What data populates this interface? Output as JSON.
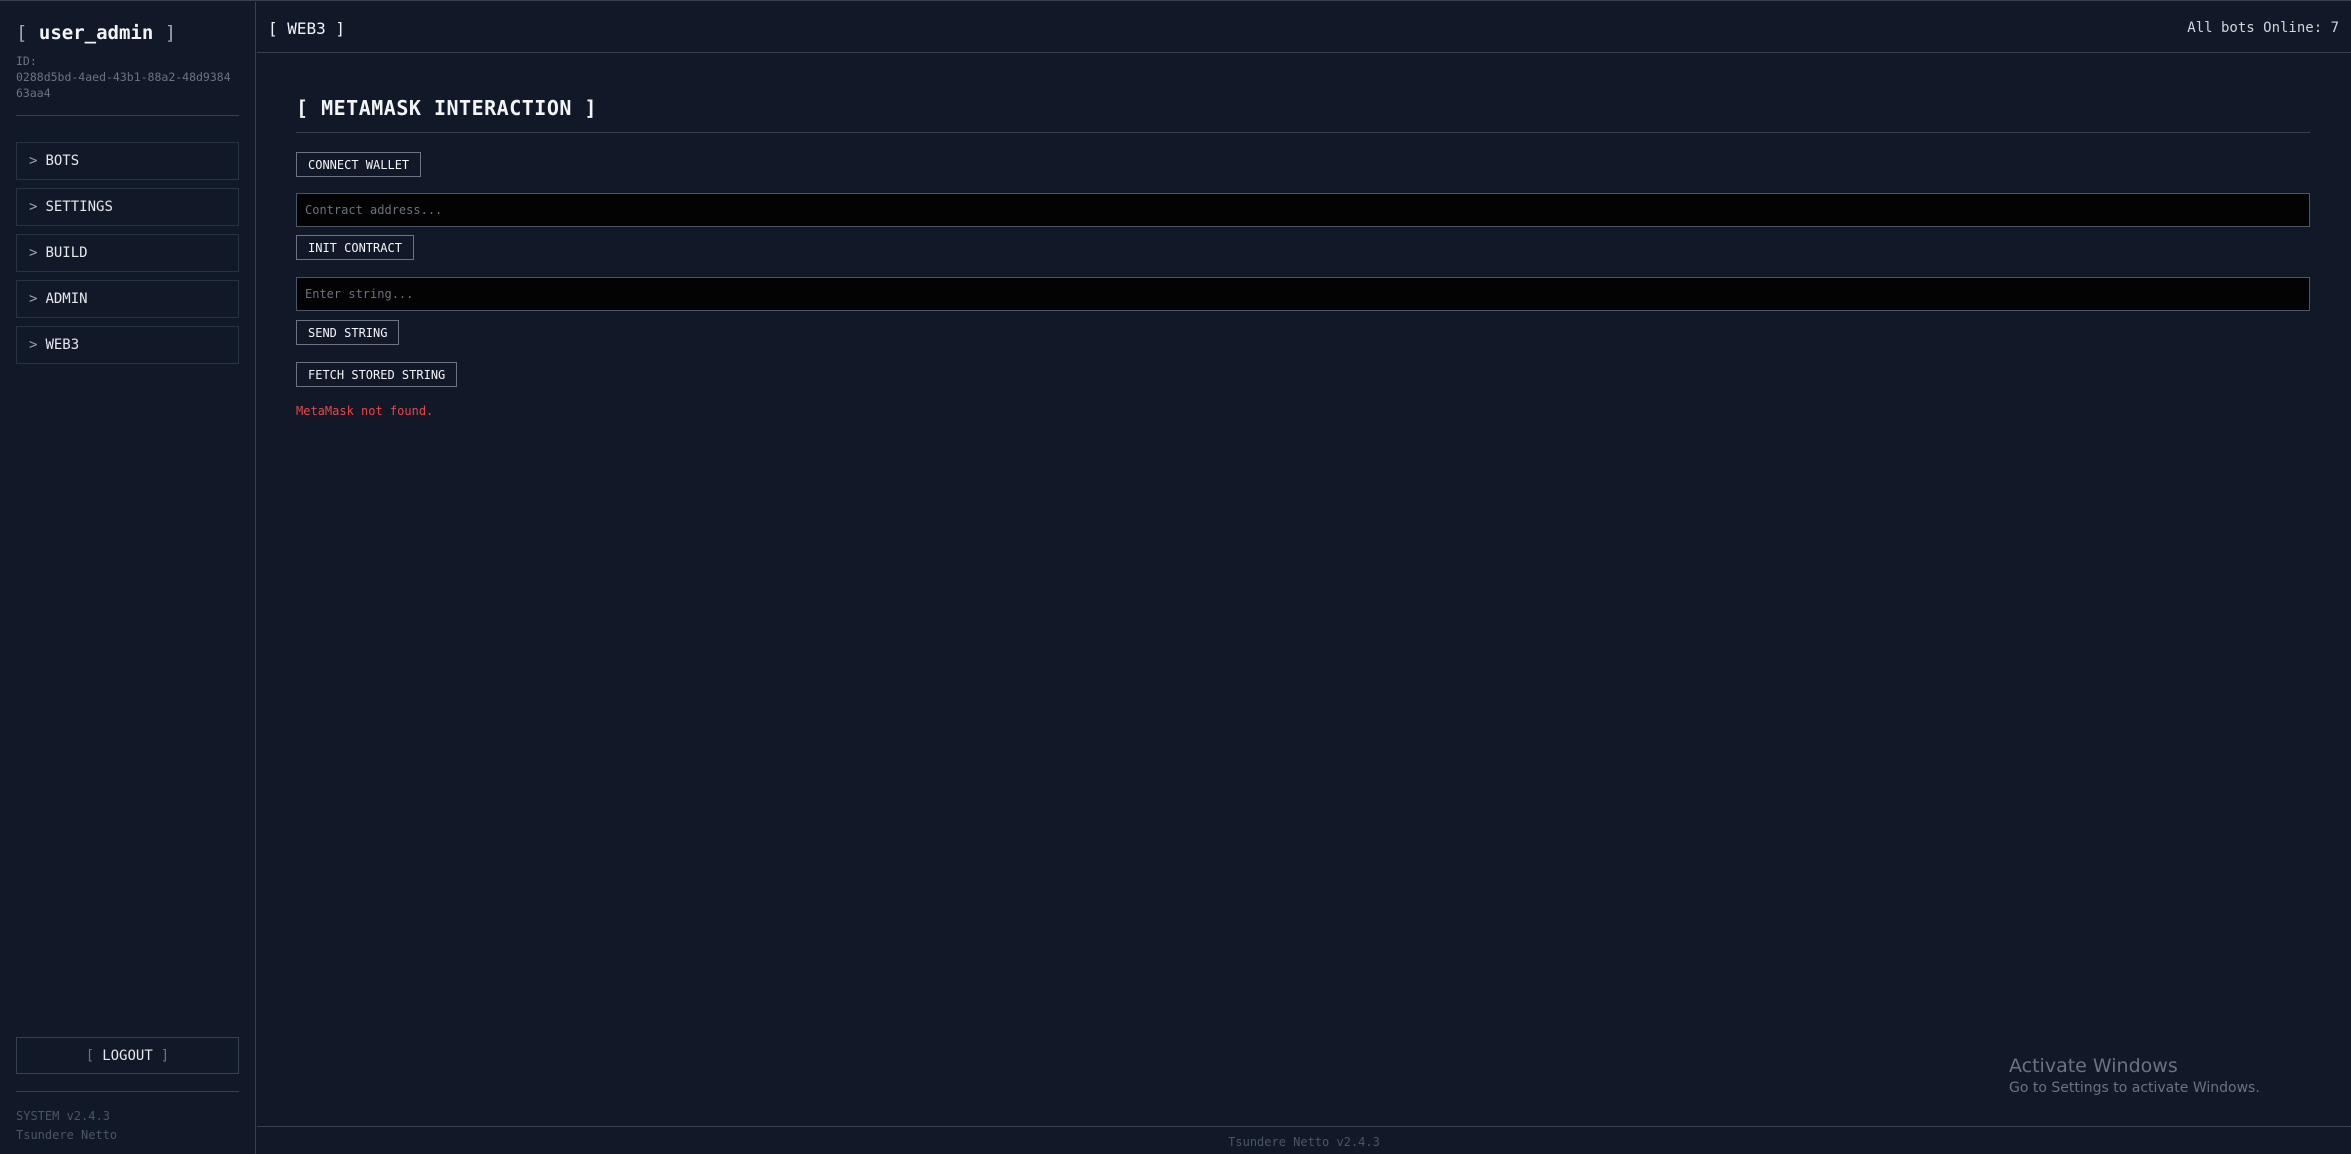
{
  "sidebar": {
    "username": "user_admin",
    "id_label": "ID:",
    "id_value": "0288d5bd-4aed-43b1-88a2-48d938463aa4",
    "nav": [
      {
        "label": "BOTS"
      },
      {
        "label": "SETTINGS"
      },
      {
        "label": "BUILD"
      },
      {
        "label": "ADMIN"
      },
      {
        "label": "WEB3"
      }
    ],
    "logout_label": "LOGOUT",
    "system_version": "SYSTEM v2.4.3",
    "system_name": "Tsundere Netto"
  },
  "header": {
    "title": "[ WEB3 ]",
    "status": "All bots Online: 7"
  },
  "main": {
    "section_title": "[ METAMASK INTERACTION ]",
    "connect_wallet_label": "CONNECT WALLET",
    "contract_placeholder": "Contract address...",
    "init_contract_label": "INIT CONTRACT",
    "string_placeholder": "Enter string...",
    "send_string_label": "SEND STRING",
    "fetch_string_label": "FETCH STORED STRING",
    "error_message": "MetaMask not found."
  },
  "footer": {
    "text": "Tsundere Netto v2.4.3"
  },
  "watermark": {
    "title": "Activate Windows",
    "subtitle": "Go to Settings to activate Windows."
  },
  "colors": {
    "background": "#111827",
    "border": "#374151",
    "error": "#ef4444",
    "input_background": "#030303"
  }
}
